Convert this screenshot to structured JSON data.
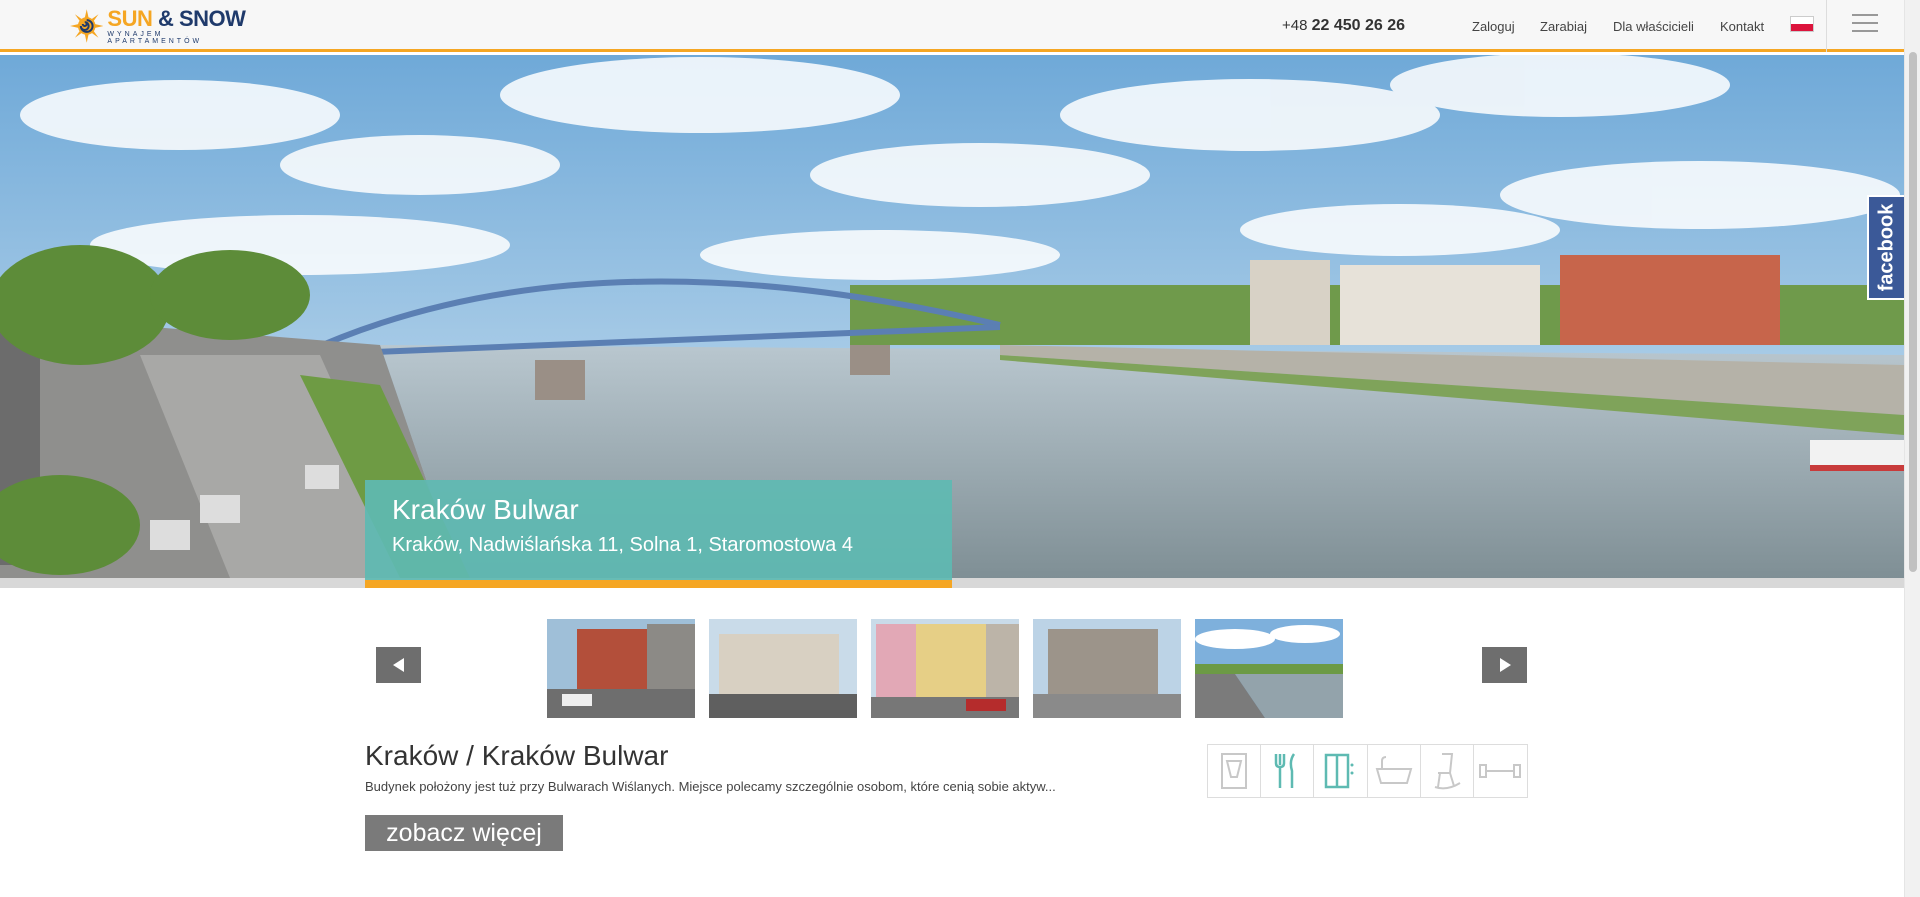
{
  "header": {
    "logo_main_sun": "SUN",
    "logo_main_amp": "&",
    "logo_main_snow": "SNOW",
    "logo_sub": "WYNAJEM APARTAMENTÓW",
    "phone_prefix": "+48",
    "phone_number": "22 450 26 26",
    "nav": [
      {
        "label": "Zaloguj"
      },
      {
        "label": "Zarabiaj"
      },
      {
        "label": "Dla właścicieli"
      },
      {
        "label": "Kontakt"
      }
    ],
    "language_flag": "pl-flag-icon",
    "menu_icon": "hamburger-menu-icon"
  },
  "hero": {
    "title": "Kraków Bulwar",
    "address": "Kraków, Nadwiślańska 11, Solna 1, Staromostowa 4",
    "facebook_label": "facebook"
  },
  "gallery": {
    "prev_icon": "arrow-left-icon",
    "next_icon": "arrow-right-icon",
    "thumbnails": [
      {
        "name": "thumb-brick-building"
      },
      {
        "name": "thumb-townhouse-square"
      },
      {
        "name": "thumb-yellow-townhouse"
      },
      {
        "name": "thumb-modern-building"
      },
      {
        "name": "thumb-river-view"
      }
    ]
  },
  "content": {
    "title": "Kraków / Kraków Bulwar",
    "description": "Budynek położony jest tuż przy Bulwarach Wiślanych. Miejsce polecamy szczególnie osobom, które cenią sobie aktyw...",
    "more_button": "zobacz więcej"
  },
  "amenities": [
    {
      "icon": "coffee-machine-icon",
      "active": false
    },
    {
      "icon": "kitchen-cutlery-icon",
      "active": true
    },
    {
      "icon": "wardrobe-icon",
      "active": true
    },
    {
      "icon": "bathtub-icon",
      "active": false
    },
    {
      "icon": "rocking-chair-icon",
      "active": false
    },
    {
      "icon": "dumbbell-icon",
      "active": false
    }
  ],
  "colors": {
    "accent": "#f5a623",
    "caption_bg": "#5ebab2",
    "facebook": "#3b5998",
    "amenity_active": "#5ebab2",
    "amenity_inactive": "#c8c8c8"
  }
}
